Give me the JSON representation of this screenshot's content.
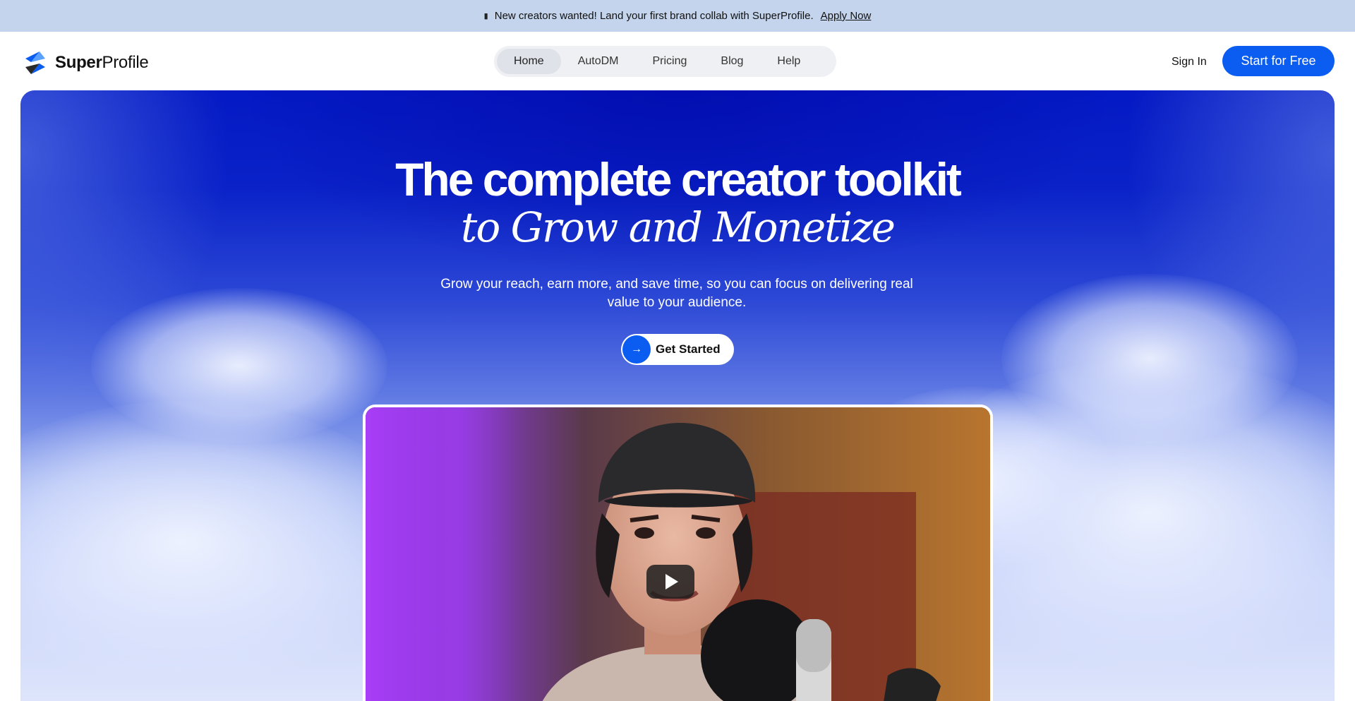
{
  "announcement": {
    "icon": "bell-icon",
    "text": "New creators wanted! Land your first brand collab with SuperProfile.",
    "link_label": "Apply Now"
  },
  "brand": {
    "name_bold": "Super",
    "name_regular": "Profile",
    "color": "#0a5df0"
  },
  "nav": {
    "items": [
      {
        "label": "Home",
        "active": true
      },
      {
        "label": "AutoDM",
        "active": false
      },
      {
        "label": "Pricing",
        "active": false
      },
      {
        "label": "Blog",
        "active": false
      },
      {
        "label": "Help",
        "active": false
      }
    ],
    "sign_in_label": "Sign In",
    "cta_label": "Start for Free"
  },
  "hero": {
    "headline": "The complete creator toolkit",
    "headline_italic": "to Grow and Monetize",
    "subheadline": "Grow your reach, earn more, and save time, so you can focus on delivering real value to your audience.",
    "cta_label": "Get Started",
    "cta_icon": "arrow-right-icon"
  },
  "video": {
    "play_icon": "play-icon"
  },
  "colors": {
    "accent": "#0a5df0",
    "announcement_bg": "#c3d4ec",
    "hero_top": "#0419c4",
    "hero_bottom": "#dfe6fc"
  }
}
